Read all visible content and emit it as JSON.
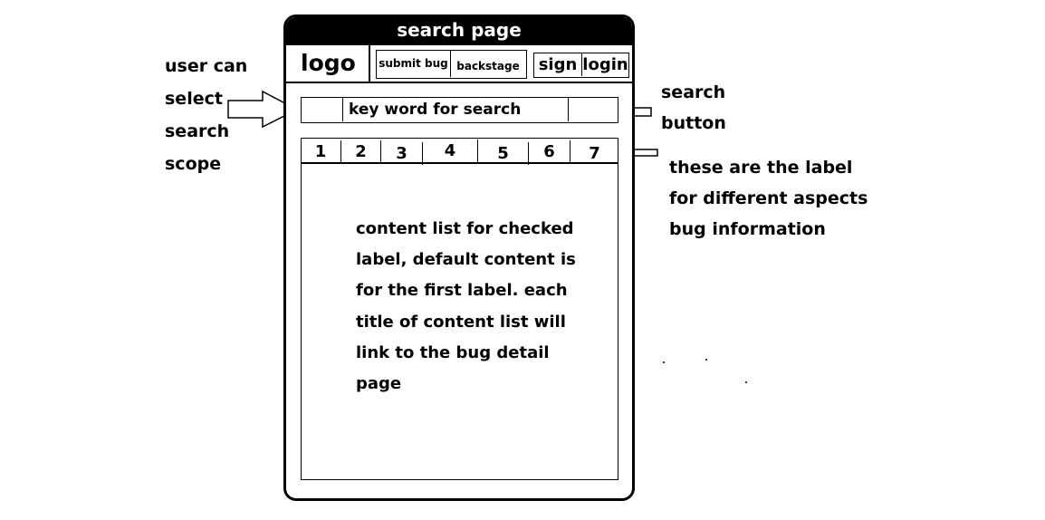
{
  "phone": {
    "title": "search page",
    "header": {
      "logo": "logo",
      "submit_bug": "submit bug",
      "backstage": "backstage",
      "sign": "sign",
      "login": "login"
    },
    "search": {
      "keyword": "key word for search"
    },
    "tabs": [
      "1",
      "2",
      "3",
      "4",
      "5",
      "6",
      "7"
    ],
    "content": [
      "content list for checked",
      "label, default content is",
      "for the first label. each",
      "title of content list will",
      "link to the bug detail",
      "page"
    ]
  },
  "annotations": {
    "scope": [
      "user can",
      "select",
      "search",
      "scope"
    ],
    "search_button": [
      "search",
      "button"
    ],
    "labels": [
      "these are the label",
      "for different aspects",
      "bug information"
    ]
  }
}
